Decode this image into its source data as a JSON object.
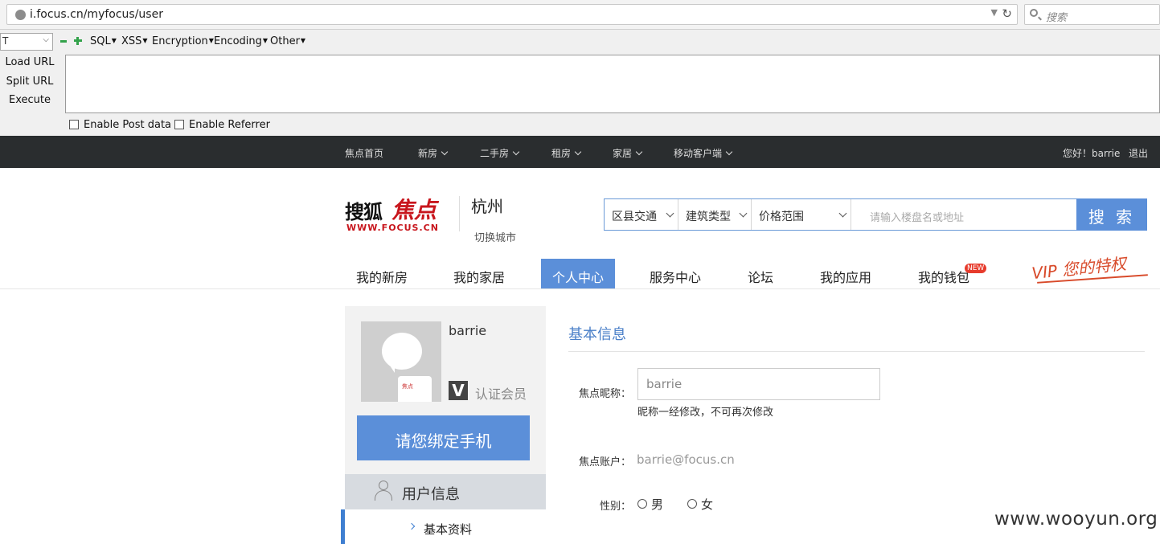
{
  "browser": {
    "url": "i.focus.cn/myfocus/user",
    "search_placeholder": "搜索"
  },
  "hackbar": {
    "select_value": "T",
    "menus": [
      "SQL",
      "XSS",
      "Encryption",
      "Encoding",
      "Other"
    ],
    "actions": [
      "Load URL",
      "Split URL",
      "Execute"
    ],
    "textarea_value": "",
    "checkboxes": [
      "Enable Post data",
      "Enable Referrer"
    ]
  },
  "topnav": {
    "items": [
      "焦点首页",
      "新房",
      "二手房",
      "租房",
      "家居",
      "移动客户端"
    ],
    "greeting": "您好！barrie",
    "logout": "退出"
  },
  "header": {
    "logo_text": "搜狐",
    "logo_brand": "焦点",
    "logo_url": "WWW.FOCUS.CN",
    "city": "杭州",
    "switch_city": "切换城市",
    "search": {
      "filters": [
        "区县交通",
        "建筑类型",
        "价格范围"
      ],
      "placeholder": "请输入楼盘名或地址",
      "button": "搜 索"
    }
  },
  "mainnav": {
    "items": [
      "我的新房",
      "我的家居",
      "个人中心",
      "服务中心",
      "论坛",
      "我的应用",
      "我的钱包"
    ],
    "active": "个人中心",
    "new_badge": "NEW",
    "vip_text": "VIP 您的特权"
  },
  "sidebar": {
    "username": "barrie",
    "avatar_mark": "焦点",
    "verified_icon": "V",
    "verified_label": "认证会员",
    "bind_phone": "请您绑定手机",
    "section": "用户信息",
    "sub_item": "基本资料"
  },
  "form": {
    "title": "基本信息",
    "nickname_label": "焦点昵称：",
    "nickname_value": "barrie",
    "nickname_hint": "昵称一经修改，不可再次修改",
    "account_label": "焦点账户：",
    "account_value": "barrie@focus.cn",
    "gender_label": "性别：",
    "gender_options": [
      "男",
      "女"
    ]
  },
  "watermark": "www.wooyun.org"
}
